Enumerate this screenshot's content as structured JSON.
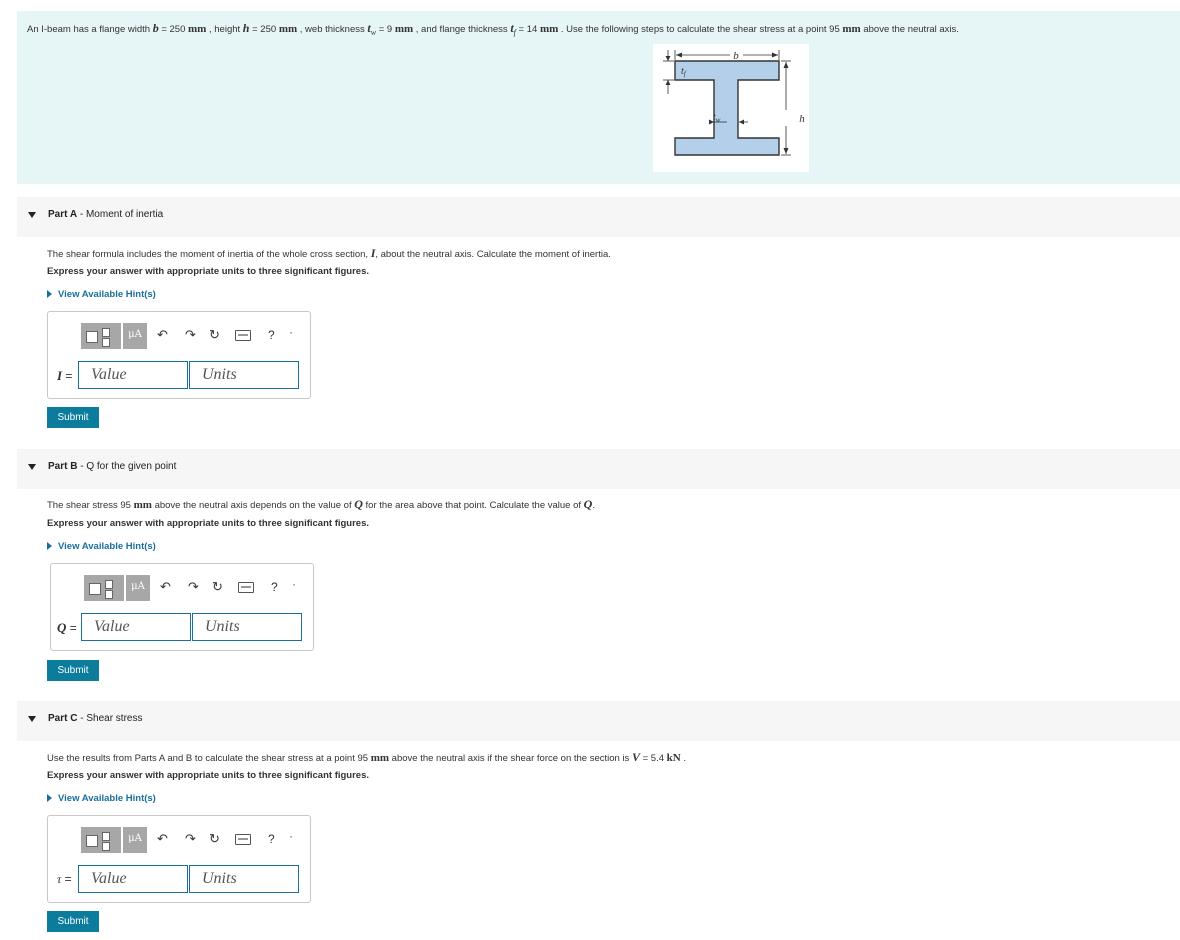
{
  "problem": {
    "p1": "An I-beam has a flange width ",
    "b_sym": "b",
    "p2": " = 250 ",
    "mm1": "mm",
    "p3": " , height ",
    "h_sym": "h",
    "p4": " = 250 ",
    "mm2": "mm",
    "p5": " , web thickness ",
    "tw_sym": "t",
    "tw_sub": "w",
    "p6": " = 9 ",
    "mm3": "mm",
    "p7": " , and flange thickness ",
    "tf_sym": "t",
    "tf_sub": "f",
    "p8": " = 14 ",
    "mm4": "mm",
    "p9": " . Use the following steps to calculate the shear stress at a point 95 ",
    "mm5": "mm",
    "p10": " above the neutral axis."
  },
  "diagram": {
    "label_b": "b",
    "label_tf": "t",
    "label_tf_sub": "f",
    "label_tw": "t",
    "label_tw_sub": "w",
    "label_h": "h",
    "fill_color": "#b4cfea",
    "stroke_color": "#333333"
  },
  "toolbar": {
    "mu": "μA",
    "undo": "↶",
    "redo": "↷",
    "reset": "↻",
    "help": "?",
    "more": "·"
  },
  "parts": [
    {
      "letter": "Part A",
      "title": " - Moment of inertia",
      "prompt_a": "The shear formula includes the moment of inertia of the whole cross section, ",
      "prompt_sym": "I",
      "prompt_b": ", about the neutral axis. Calculate the moment of inertia.",
      "instruction": "Express your answer with appropriate units to three significant figures.",
      "hint": "View Available Hint(s)",
      "var": "I",
      "eq": " =",
      "value_placeholder": "Value",
      "units_placeholder": "Units",
      "submit": "Submit"
    },
    {
      "letter": "Part B",
      "title": " - Q for the given point",
      "prompt_a": "The shear stress 95 ",
      "prompt_mm": "mm",
      "prompt_b": " above the neutral axis depends on the value of ",
      "prompt_sym": "Q",
      "prompt_c": " for the area above that point. Calculate the value of ",
      "prompt_sym2": "Q",
      "prompt_d": ".",
      "instruction": "Express your answer with appropriate units to three significant figures.",
      "hint": "View Available Hint(s)",
      "var": "Q",
      "eq": " =",
      "value_placeholder": "Value",
      "units_placeholder": "Units",
      "submit": "Submit"
    },
    {
      "letter": "Part C",
      "title": " - Shear stress",
      "prompt_a": "Use the results from Parts A and B to calculate the shear stress at a point 95 ",
      "prompt_mm": "mm",
      "prompt_b": " above the neutral axis if the shear force on the section is ",
      "prompt_sym": "V",
      "prompt_c": " = 5.4 ",
      "prompt_kn": "kN",
      "prompt_d": " .",
      "instruction": "Express your answer with appropriate units to three significant figures.",
      "hint": "View Available Hint(s)",
      "var": "τ",
      "eq": " =",
      "value_placeholder": "Value",
      "units_placeholder": "Units",
      "submit": "Submit"
    }
  ]
}
